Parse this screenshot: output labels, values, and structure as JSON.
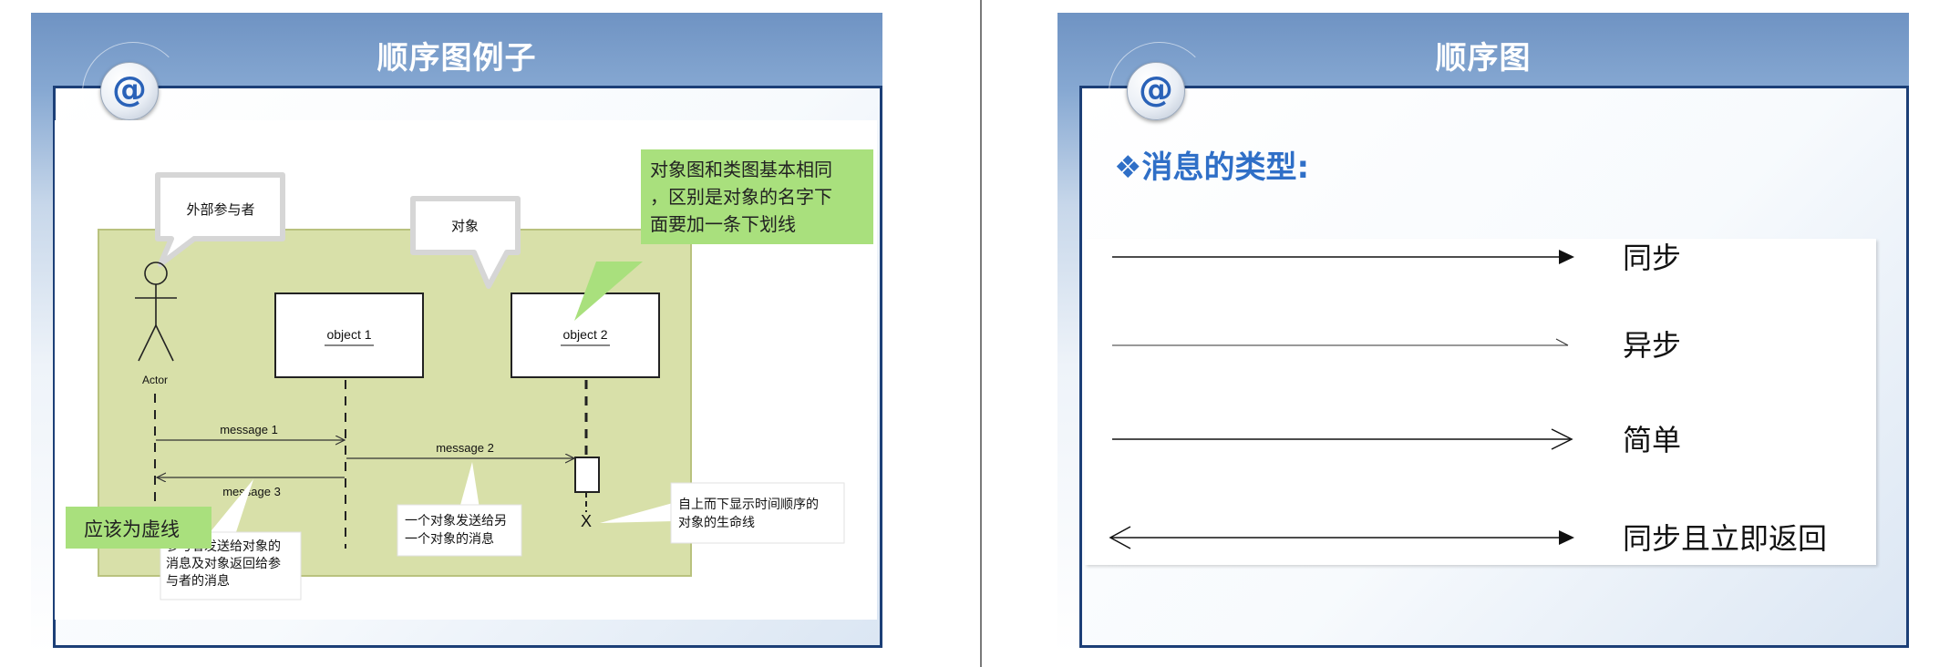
{
  "left_slide": {
    "title": "顺序图例子",
    "badge_symbol": "@",
    "diagram": {
      "callout_actor": "外部参与者",
      "callout_object": "对象",
      "actor_label": "Actor",
      "object1_label": "object 1",
      "object2_label": "object 2",
      "message1": "message 1",
      "message2": "message 2",
      "message3": "message 3",
      "lifeline_end_symbol": "X",
      "note_underline_lines": [
        "对象图和类图基本相同",
        "，区别是对象的名字下",
        "面要加一条下划线"
      ],
      "note_dashed": "应该为虚线",
      "note_actor_msg_lines": [
        "参与者发送给对象的",
        "消息及对象返回给参",
        "与者的消息"
      ],
      "note_obj_msg_lines": [
        "一个对象发送给另",
        "一个对象的消息"
      ],
      "note_lifeline_lines": [
        "自上而下显示时间顺序的",
        "对象的生命线"
      ]
    }
  },
  "right_slide": {
    "title": "顺序图",
    "badge_symbol": "@",
    "heading": "❖消息的类型:",
    "message_types": [
      {
        "label": "同步",
        "arrow": "synchronous"
      },
      {
        "label": "异步",
        "arrow": "asynchronous"
      },
      {
        "label": "简单",
        "arrow": "simple"
      },
      {
        "label": "同步且立即返回",
        "arrow": "synchronous-return"
      }
    ]
  },
  "colors": {
    "frame_border": "#1c3f77",
    "diagram_bg": "#d8e0a9",
    "note_green": "#a9e07d",
    "heading_blue": "#2f6fc7"
  }
}
